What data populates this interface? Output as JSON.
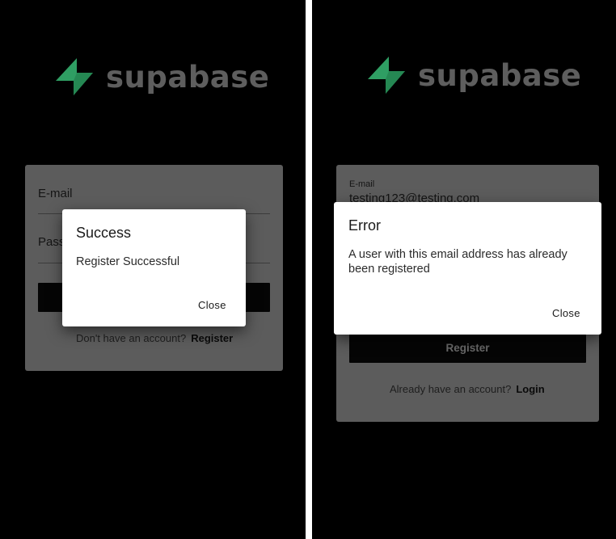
{
  "colors": {
    "logo_green": "#2f9e63",
    "logo_green_dark": "#1f7a4a",
    "logo_text": "#5e5e5e",
    "card_bg": "#5c5c5c",
    "dialog_bg": "#ffffff",
    "screen_bg": "#000000"
  },
  "left": {
    "logo_text": "supabase",
    "email_label": "E-mail",
    "password_label": "Pass",
    "footer_prompt": "Don't have an account?",
    "footer_link": "Register",
    "dialog": {
      "title": "Success",
      "message": "Register Successful",
      "close_label": "Close"
    }
  },
  "right": {
    "logo_text": "supabase",
    "email_label": "E-mail",
    "email_value": "testing123@testing.com",
    "register_button": "Register",
    "footer_prompt": "Already have an account?",
    "footer_link": "Login",
    "dialog": {
      "title": "Error",
      "message_line1": "A user with this email address has already",
      "message_line2": "been registered",
      "close_label": "Close"
    }
  }
}
